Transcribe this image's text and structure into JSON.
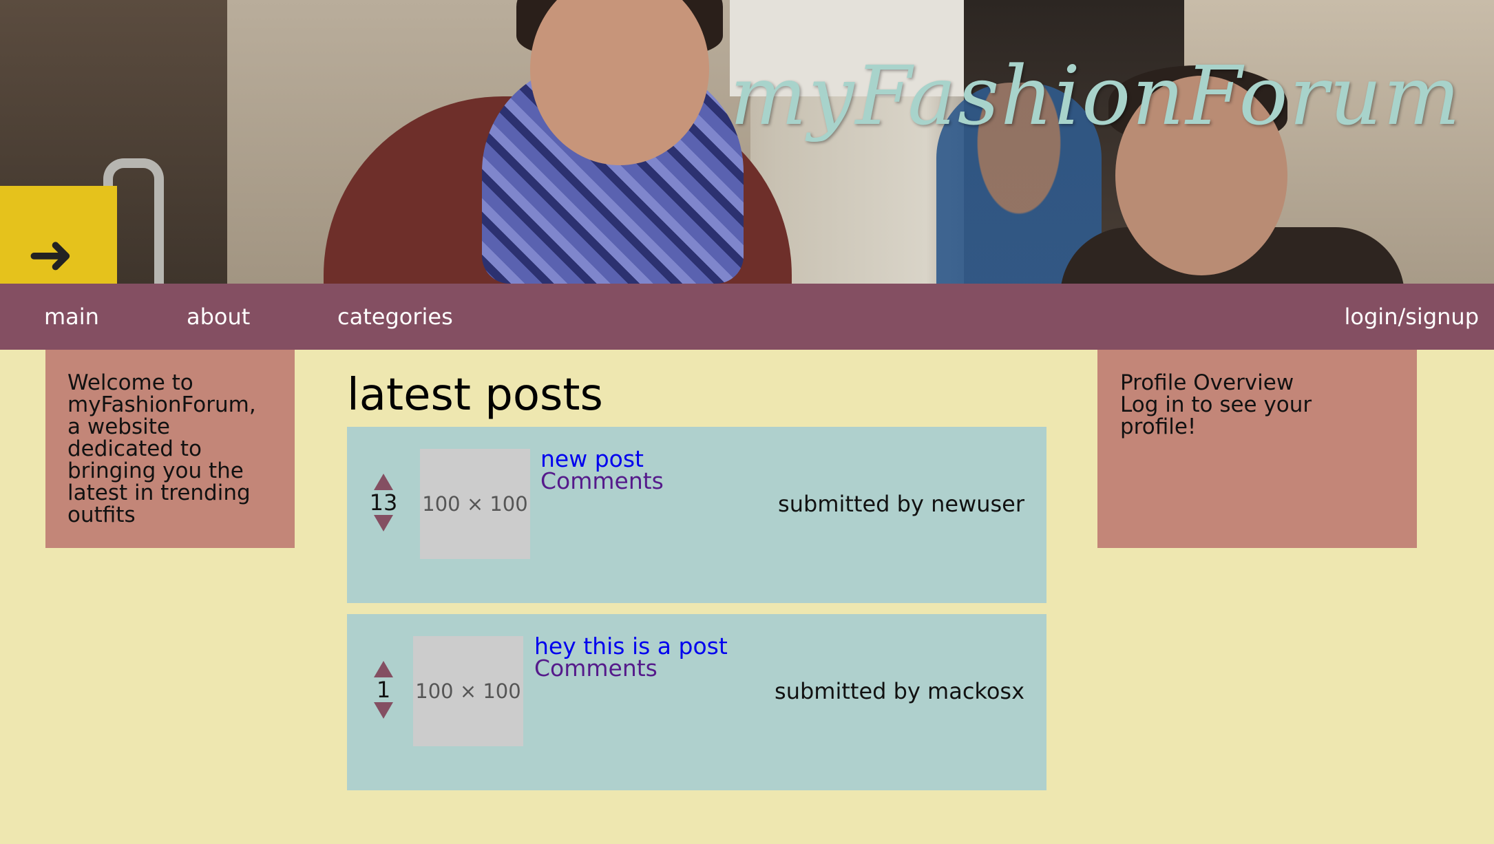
{
  "site": {
    "logo_text": "myFashionForum"
  },
  "nav": {
    "items": [
      {
        "label": "main"
      },
      {
        "label": "about"
      },
      {
        "label": "categories"
      }
    ],
    "login_label": "login/signup"
  },
  "sidebar_left": {
    "text": "Welcome to myFashionForum, a website dedicated to bringing you the latest in trending outfits"
  },
  "sidebar_right": {
    "title": "Profile Overview",
    "message": "Log in to see your profile!"
  },
  "main": {
    "heading": "latest posts",
    "posts": [
      {
        "score": "13",
        "thumbnail": "100 × 100",
        "title": "new post",
        "comments_label": "Comments",
        "submitted": "submitted by newuser"
      },
      {
        "score": "1",
        "thumbnail": "100 × 100",
        "title": "hey this is a post",
        "comments_label": "Comments",
        "submitted": "submitted by mackosx"
      }
    ]
  },
  "colors": {
    "background": "#EEE7B0",
    "nav": "#844F62",
    "sidebar": "#C38678",
    "post_card": "#AFD0CD",
    "logo": "#A8D3CB"
  }
}
